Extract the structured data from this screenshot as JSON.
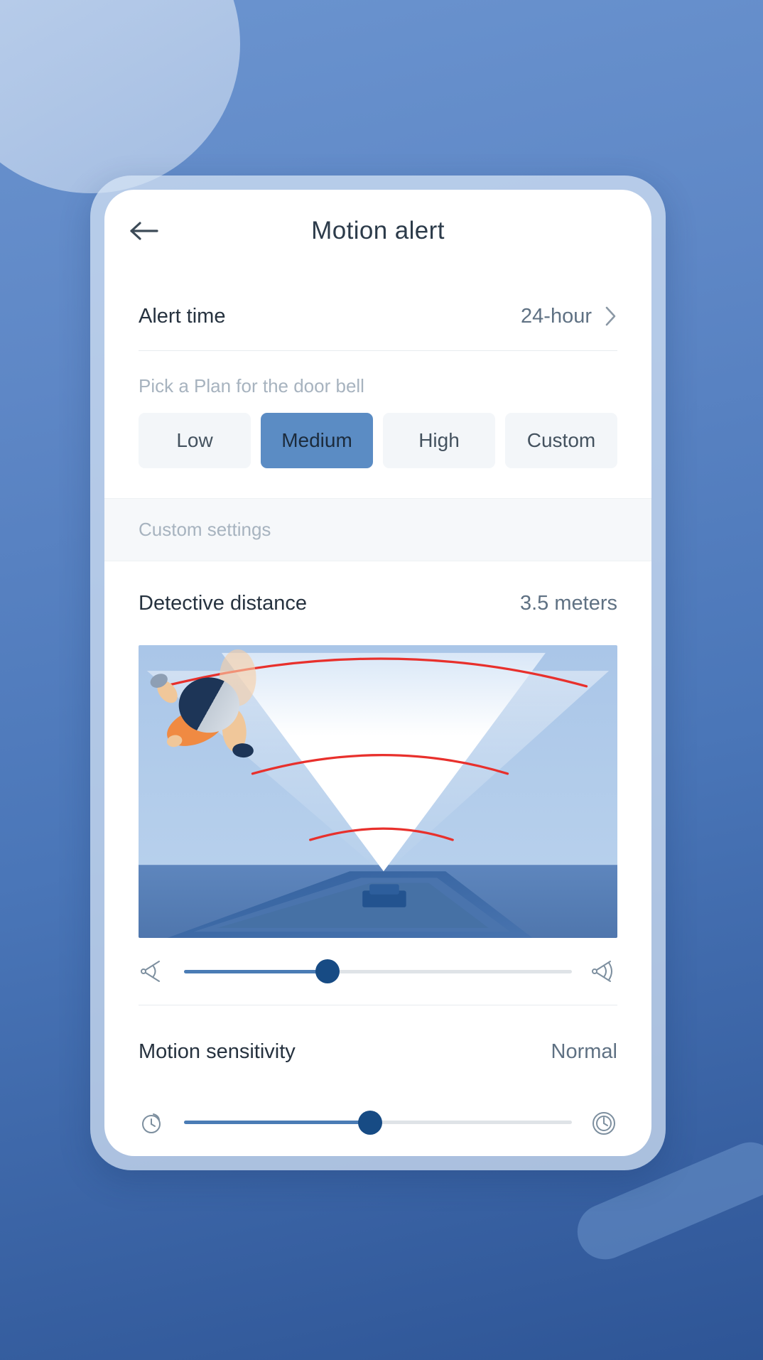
{
  "theme": {
    "bg_top": "#6b94cf",
    "bg_bottom": "#2e5596",
    "accent": "#5b8cc4",
    "knob": "#174b84",
    "track_fill": "#4a7cb5",
    "track_bg": "#dfe3e7",
    "cone_arc": "#e8302c"
  },
  "appbar": {
    "back_icon": "arrow-left-icon",
    "title": "Motion alert"
  },
  "alert_time": {
    "label": "Alert time",
    "value": "24-hour",
    "chevron_icon": "chevron-right-icon"
  },
  "plan": {
    "caption": "Pick a Plan for the door bell",
    "options": [
      {
        "label": "Low",
        "selected": false
      },
      {
        "label": "Medium",
        "selected": true
      },
      {
        "label": "High",
        "selected": false
      },
      {
        "label": "Custom",
        "selected": false
      }
    ]
  },
  "custom_settings": {
    "section_label": "Custom settings",
    "detective_distance": {
      "label": "Detective distance",
      "value": "3.5 meters",
      "slider": {
        "percent": 37,
        "left_icon": "narrow-cone-icon",
        "right_icon": "wide-cone-icon"
      }
    },
    "motion_sensitivity": {
      "label": "Motion sensitivity",
      "value": "Normal",
      "slider": {
        "percent": 48,
        "left_icon": "stopwatch-icon",
        "right_icon": "stopwatch-double-icon"
      }
    }
  },
  "illustration": {
    "name": "detection-cone-illustration",
    "arcs": 3,
    "person": "walking-person-top-down",
    "sensor": "doorbell-sensor"
  }
}
